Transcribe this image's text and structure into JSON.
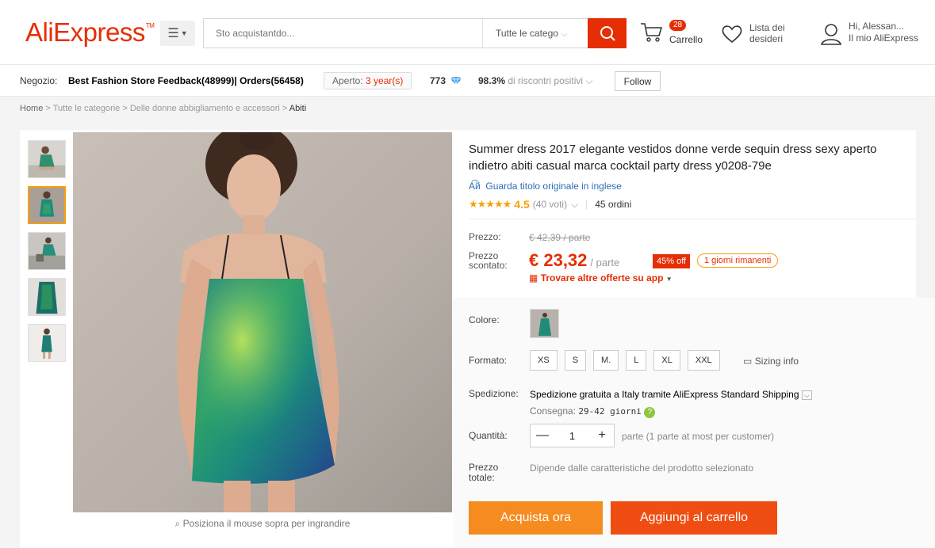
{
  "header": {
    "logo": "AliExpress",
    "logo_tm": "TM",
    "search_placeholder": "Sto acquistantdo...",
    "search_category": "Tutte le catego",
    "cart_count": "28",
    "cart_label": "Carrello",
    "wishlist_line1": "Lista dei",
    "wishlist_line2": "desideri",
    "account_line1": "Hi, Alessan...",
    "account_line2": "Il mio AliExpress"
  },
  "store": {
    "label": "Negozio:",
    "name": "Best Fashion Store Feedback(48999)| Orders(56458)",
    "open_label": "Aperto:",
    "open_value": "3 year(s)",
    "score": "773",
    "positive_pct": "98.3%",
    "positive_label": "di riscontri positivi",
    "follow": "Follow"
  },
  "breadcrumb": {
    "items": [
      "Home",
      "Tutte le categorie",
      "Delle donne abbigliamento e accessori"
    ],
    "sep": ">",
    "current": "Abiti"
  },
  "gallery": {
    "zoom_hint": "Posiziona il mouse sopra per ingrandire"
  },
  "product": {
    "title": "Summer dress 2017 elegante vestidos donne verde sequin dress sexy aperto indietro abiti casual marca cocktail party dress y0208-79e",
    "translate_link": "Guarda titolo originale in inglese",
    "rating": "4.5",
    "votes": "(40 voti)",
    "orders": "45 ordini",
    "price_label": "Prezzo:",
    "old_price": "€ 42,39 / parte",
    "discount_label_1": "Prezzo",
    "discount_label_2": "scontato:",
    "new_price": "€ 23,32",
    "unit": "/ parte",
    "off": "45% off",
    "days_left": "1 giorni rimanenti",
    "app_deal": "Trovare altre offerte su app"
  },
  "options": {
    "color_label": "Colore:",
    "size_label": "Formato:",
    "sizes": [
      "XS",
      "S",
      "M.",
      "L",
      "XL",
      "XXL"
    ],
    "sizing_info": "Sizing info",
    "shipping_label": "Spedizione:",
    "shipping_text": "Spedizione gratuita a Italy tramite AliExpress Standard Shipping",
    "delivery_label": "Consegna:",
    "delivery_value": "29-42 giorni",
    "qty_label": "Quantità:",
    "qty_value": "1",
    "qty_note": "parte (1 parte at most per customer)",
    "total_label_1": "Prezzo",
    "total_label_2": "totale:",
    "total_note": "Dipende dalle caratteristiche del prodotto selezionato"
  },
  "actions": {
    "buy_now": "Acquista ora",
    "add_to_cart": "Aggiungi al carrello"
  },
  "colors": {
    "brand": "#e62e04",
    "buy": "#f68b1f",
    "cart": "#f04d12",
    "star": "#f7a00b"
  }
}
